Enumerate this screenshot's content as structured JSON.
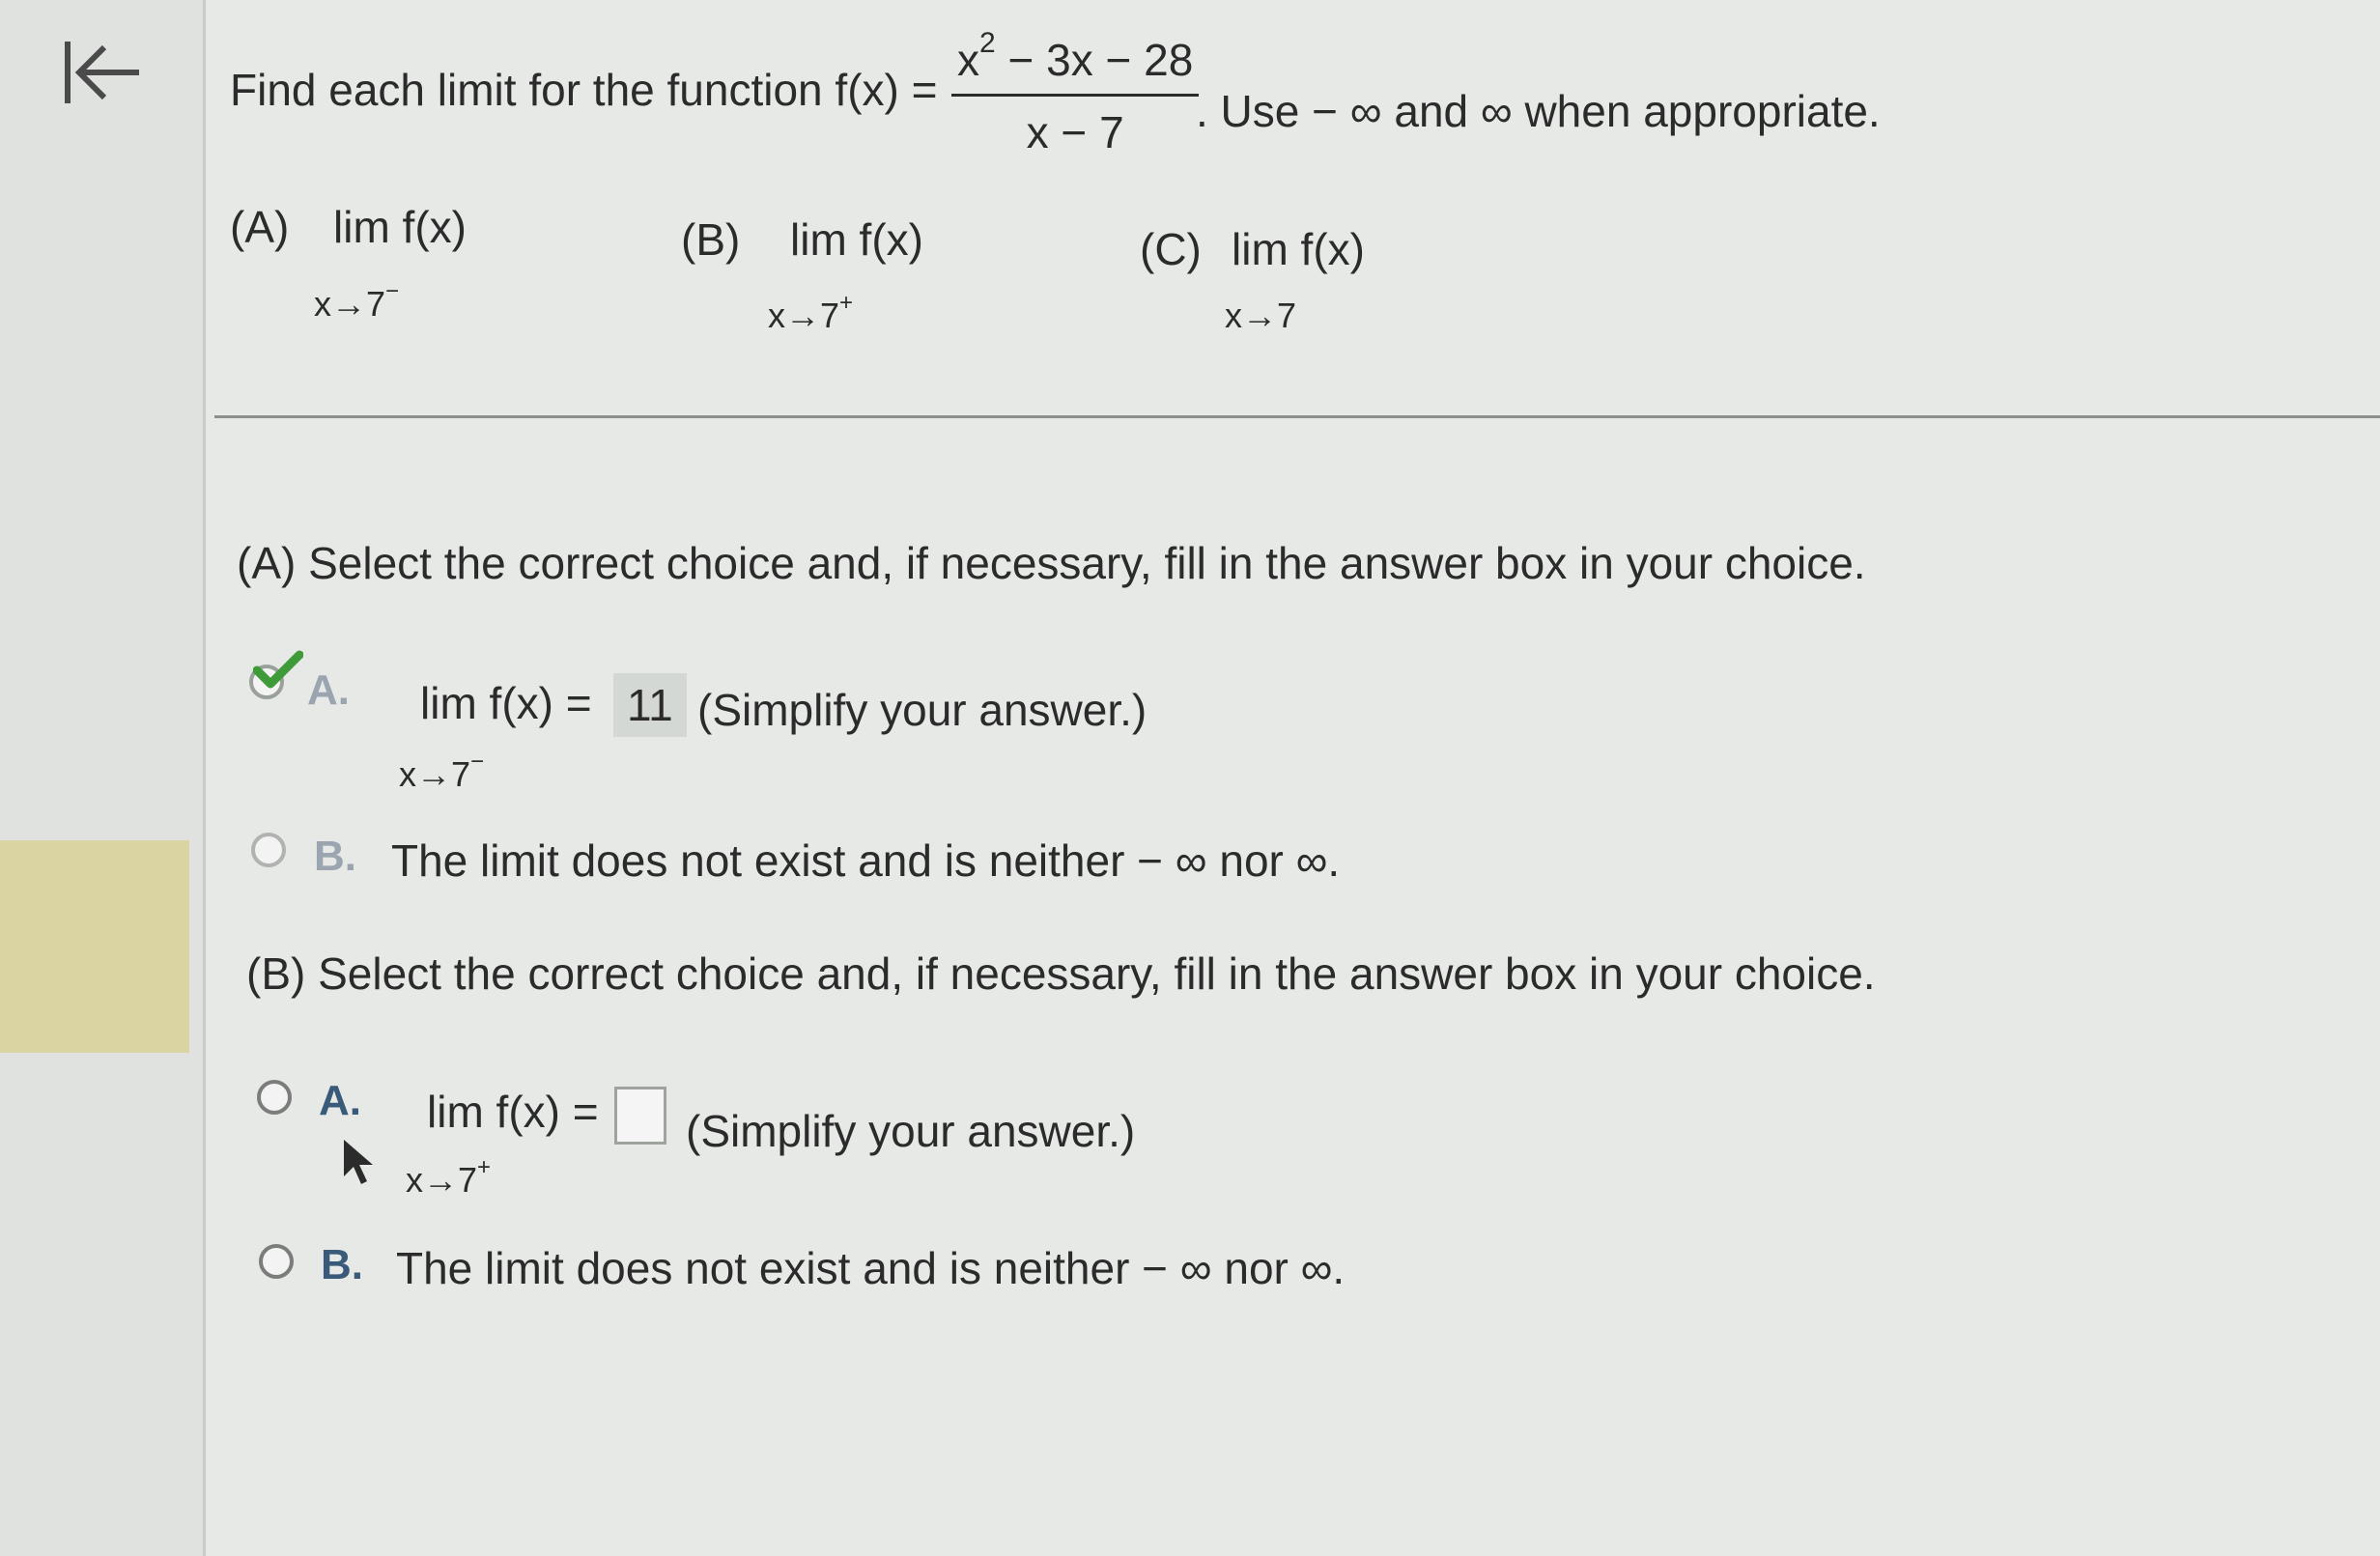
{
  "question": {
    "prefix": "Find each limit for the function f(x) =",
    "numerator_a": "x",
    "numerator_sup": "2",
    "numerator_b": " − 3x − 28",
    "denominator": "x − 7",
    "suffix": ". Use − ∞ and ∞ when appropriate."
  },
  "parts": [
    {
      "label": "(A)",
      "lim": "lim  f(x)",
      "sub": "x→7",
      "sup": "−"
    },
    {
      "label": "(B)",
      "lim": "lim  f(x)",
      "sub": "x→7",
      "sup": "+"
    },
    {
      "label": "(C)",
      "lim": "lim  f(x)",
      "sub": "x→7",
      "sup": ""
    }
  ],
  "section_a": {
    "prompt": "(A) Select the correct choice and, if necessary, fill in the answer box in your choice.",
    "choice_a_letter": "A.",
    "choice_a_lim": "lim  f(x) =",
    "choice_a_sub": "x→7",
    "choice_a_sup": "−",
    "choice_a_value": "11",
    "choice_a_hint": "(Simplify your answer.)",
    "choice_b_letter": "B.",
    "choice_b_text": "The limit does not exist and is neither  − ∞ nor ∞."
  },
  "section_b": {
    "prompt": "(B) Select the correct choice and, if necessary, fill in the answer box in your choice.",
    "choice_a_letter": "A.",
    "choice_a_lim": "lim  f(x) =",
    "choice_a_sub": "x→7",
    "choice_a_sup": "+",
    "choice_a_hint": "(Simplify your answer.)",
    "choice_b_letter": "B.",
    "choice_b_text": "The limit does not exist and is neither  − ∞ nor ∞."
  },
  "icons": {
    "back": "back-to-start-icon",
    "check": "checkmark-icon",
    "cursor": "mouse-pointer-icon"
  },
  "colors": {
    "check_green": "#3f9a3a",
    "letter_blue": "#3a5a7a"
  }
}
